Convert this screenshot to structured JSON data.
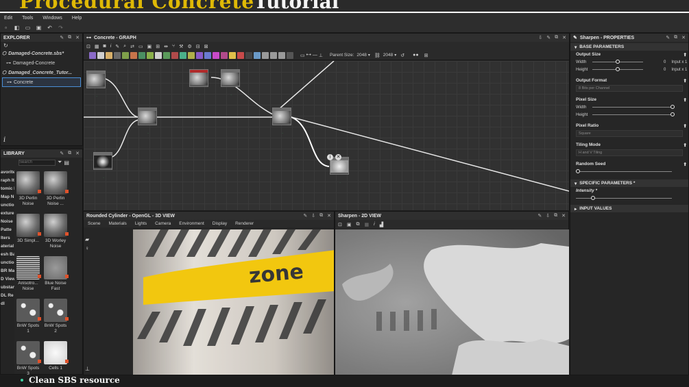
{
  "menubar": {
    "items": [
      "Edit",
      "Tools",
      "Windows",
      "Help"
    ]
  },
  "explorer": {
    "title": "EXPLORER",
    "items": [
      {
        "label": "Damaged-Concrete.sbs*",
        "italic": true
      },
      {
        "label": "Damaged-Concrete",
        "italic": false
      },
      {
        "label": "Damaged_Concrete_Tutor...",
        "italic": true
      },
      {
        "label": "Concrete",
        "italic": false
      }
    ]
  },
  "library": {
    "title": "LIBRARY",
    "search_placeholder": "Search",
    "categories": [
      "avorite",
      "raph Ite",
      "tomic N",
      "Map N",
      "unction",
      "exture",
      "Noise",
      "Patte",
      "lters",
      "aterial",
      "esh Ba",
      "unction",
      "BR Ma",
      "D View",
      "ubstanc",
      "DL Re",
      "dl"
    ],
    "tiles": [
      {
        "label": "3D Perlin Noise",
        "tone": "cube"
      },
      {
        "label": "3D Perlin Noise ...",
        "tone": "cube"
      },
      {
        "label": "3D Simpl...",
        "tone": "cube"
      },
      {
        "label": "3D Worley Noise",
        "tone": "cube"
      },
      {
        "label": "Anisotro... Noise",
        "tone": "lines"
      },
      {
        "label": "Blue Noise Fast",
        "tone": "gray"
      },
      {
        "label": "BnW Spots 1",
        "tone": "spots"
      },
      {
        "label": "BnW Spots 2",
        "tone": "spots"
      },
      {
        "label": "BnW Spots 3",
        "tone": "spots"
      },
      {
        "label": "Cells 1",
        "tone": "white"
      }
    ]
  },
  "graph": {
    "title": "Concrete - GRAPH",
    "parent_size_label": "Parent Size:",
    "parent_size": "2048",
    "size_value": "2048"
  },
  "view3d": {
    "title": "Rounded Cylinder - OpenGL - 3D VIEW",
    "menu": [
      "Scene",
      "Materials",
      "Lights",
      "Camera",
      "Environment",
      "Display",
      "Renderer"
    ],
    "decal_text": "zone"
  },
  "view2d": {
    "title": "Sharpen - 2D VIEW"
  },
  "properties": {
    "title": "Sharpen - PROPERTIES",
    "base_section": "BASE PARAMETERS",
    "output_size": "Output Size",
    "width_label": "Width",
    "height_label": "Height",
    "width_value": "0",
    "height_value": "0",
    "width_suffix": "Input x 1",
    "height_suffix": "Input x 1",
    "output_format": "Output Format",
    "output_format_value": "8 Bits per Channel",
    "pixel_size": "Pixel Size",
    "pixel_width": "Width",
    "pixel_height": "Height",
    "pixel_ratio": "Pixel Ratio",
    "pixel_ratio_value": "Square",
    "tiling_mode": "Tiling Mode",
    "tiling_mode_value": "H and V Tiling",
    "random_seed": "Random Seed",
    "specific_section": "SPECIFIC PARAMETERS *",
    "intensity": "Intensity *",
    "input_section": "INPUT VALUES"
  },
  "caption": {
    "text": "Clean SBS resource"
  },
  "colors": {
    "accent_blue": "#4a8fd6",
    "node_output_green": "#3fd16b",
    "library_badge": "#e0522b",
    "decal_yellow": "#f2c400"
  }
}
